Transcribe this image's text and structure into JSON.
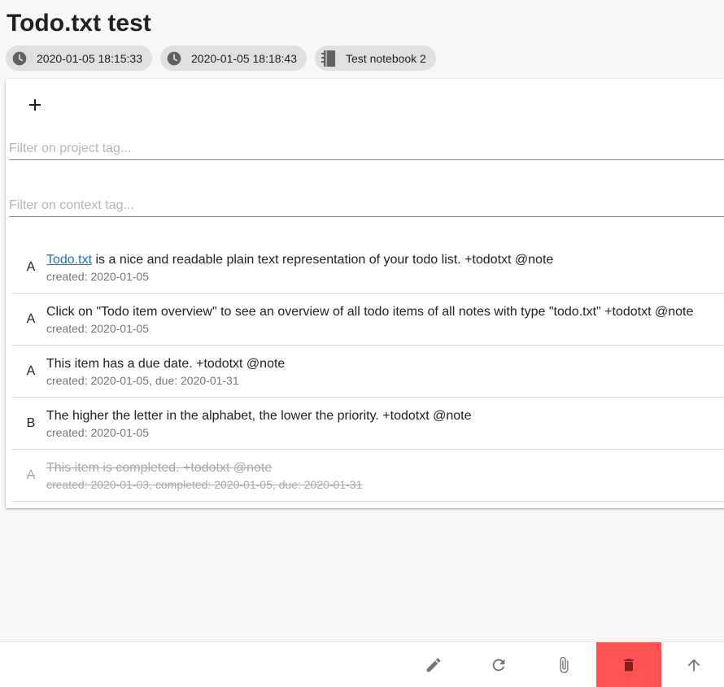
{
  "note": {
    "title": "Todo.txt test",
    "created": "2020-01-05 18:15:33",
    "updated": "2020-01-05 18:18:43",
    "notebook": "Test notebook 2"
  },
  "filters": {
    "project_placeholder": "Filter on project tag...",
    "context_placeholder": "Filter on context tag..."
  },
  "todos": [
    {
      "priority": "A",
      "link": "Todo.txt",
      "text": " is a nice and readable plain text representation of your todo list. +todotxt @note",
      "meta": "created: 2020-01-05"
    },
    {
      "priority": "A",
      "text": "Click on \"Todo item overview\" to see an overview of all todo items of all notes with type \"todo.txt\" +todotxt @note",
      "meta": "created: 2020-01-05"
    },
    {
      "priority": "A",
      "text": "This item has a due date. +todotxt @note",
      "meta": "created: 2020-01-05, due: 2020-01-31"
    },
    {
      "priority": "B",
      "text": "The higher the letter in the alphabet, the lower the priority. +todotxt @note",
      "meta": "created: 2020-01-05"
    },
    {
      "priority": "A",
      "text": "This item is completed. +todotxt @note",
      "meta": "created: 2020-01-03, completed: 2020-01-05, due: 2020-01-31",
      "completed": true
    }
  ],
  "icons": {
    "created": "clock-icon",
    "updated": "clock-icon",
    "notebook": "notebook-icon",
    "add": "plus-icon",
    "edit": "pencil-icon",
    "refresh": "refresh-icon",
    "attach": "paperclip-icon",
    "delete": "trash-icon",
    "scroll_top": "arrow-up-icon"
  },
  "colors": {
    "link": "#1e72bd",
    "delete_button": "#ff5252",
    "chip_background": "#e0e0e0"
  }
}
